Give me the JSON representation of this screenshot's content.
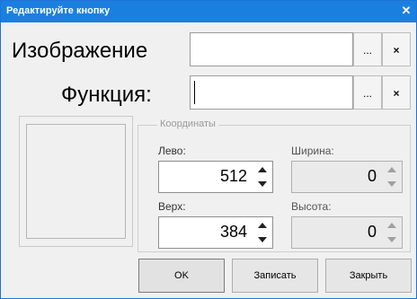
{
  "window": {
    "title": "Редактируйте кнопку",
    "close_glyph": "✕"
  },
  "image_row": {
    "label": "Изображение",
    "value": "",
    "browse_label": "...",
    "clear_label": "×"
  },
  "function_row": {
    "label": "Функция:",
    "value": "",
    "browse_label": "...",
    "clear_label": "×"
  },
  "coordinates": {
    "group_title": "Координаты",
    "left": {
      "label": "Лево:",
      "value": "512"
    },
    "top": {
      "label": "Верх:",
      "value": "384"
    },
    "width": {
      "label": "Ширина:",
      "value": "0"
    },
    "height": {
      "label": "Высота:",
      "value": "0"
    }
  },
  "buttons": {
    "ok": "OK",
    "save": "Записать",
    "close": "Закрыть"
  },
  "colors": {
    "titlebar": "#1b7fe0",
    "window_bg": "#f0f0f0"
  }
}
